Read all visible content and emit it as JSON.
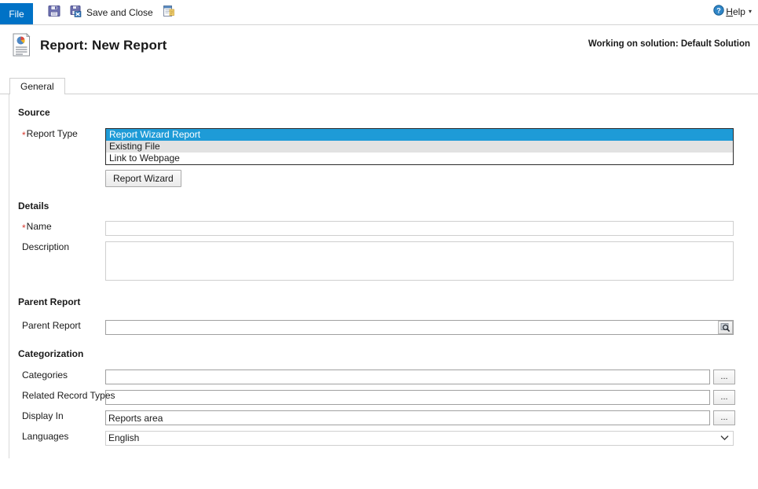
{
  "commandbar": {
    "file_tab": "File",
    "buttons": [
      {
        "label": "",
        "icon": "save-icon"
      },
      {
        "label": "Save and Close",
        "icon": "save-and-close-icon"
      },
      {
        "label": "",
        "icon": "new-record-icon"
      }
    ],
    "help_label": "Help",
    "help_accesskey": "H",
    "help_caret": "▾"
  },
  "header": {
    "title": "Report: New Report",
    "solution_note": "Working on solution: Default Solution",
    "icon": "report-document-icon"
  },
  "tabs": [
    {
      "label": "General",
      "active": true
    }
  ],
  "form": {
    "sections": {
      "source": {
        "heading": "Source",
        "report_type": {
          "label": "Report Type",
          "required": true,
          "options": [
            "Report Wizard Report",
            "Existing File",
            "Link to Webpage"
          ],
          "selected": "Report Wizard Report"
        },
        "wizard_button": "Report Wizard"
      },
      "details": {
        "heading": "Details",
        "name": {
          "label": "Name",
          "required": true,
          "value": "",
          "placeholder": ""
        },
        "description": {
          "label": "Description",
          "required": false,
          "value": "",
          "placeholder": ""
        }
      },
      "parent_report": {
        "heading": "Parent Report",
        "parent": {
          "label": "Parent Report",
          "value": "",
          "placeholder": "",
          "lookup_icon": "magnifier-lookup-icon"
        }
      },
      "categorization": {
        "heading": "Categorization",
        "categories": {
          "label": "Categories",
          "value": "",
          "button": "..."
        },
        "related_record_types": {
          "label": "Related Record Types",
          "value": "",
          "button": "..."
        },
        "display_in": {
          "label": "Display In",
          "value": "Reports area",
          "button": "..."
        },
        "languages": {
          "label": "Languages",
          "value": "English",
          "caret": "⌄"
        }
      }
    }
  },
  "colors": {
    "file_tab_blue": "#0072c6",
    "selection_blue": "#1e9bd7",
    "required_red": "#d63a2e",
    "alt_row_gray": "#e2e2e2"
  }
}
